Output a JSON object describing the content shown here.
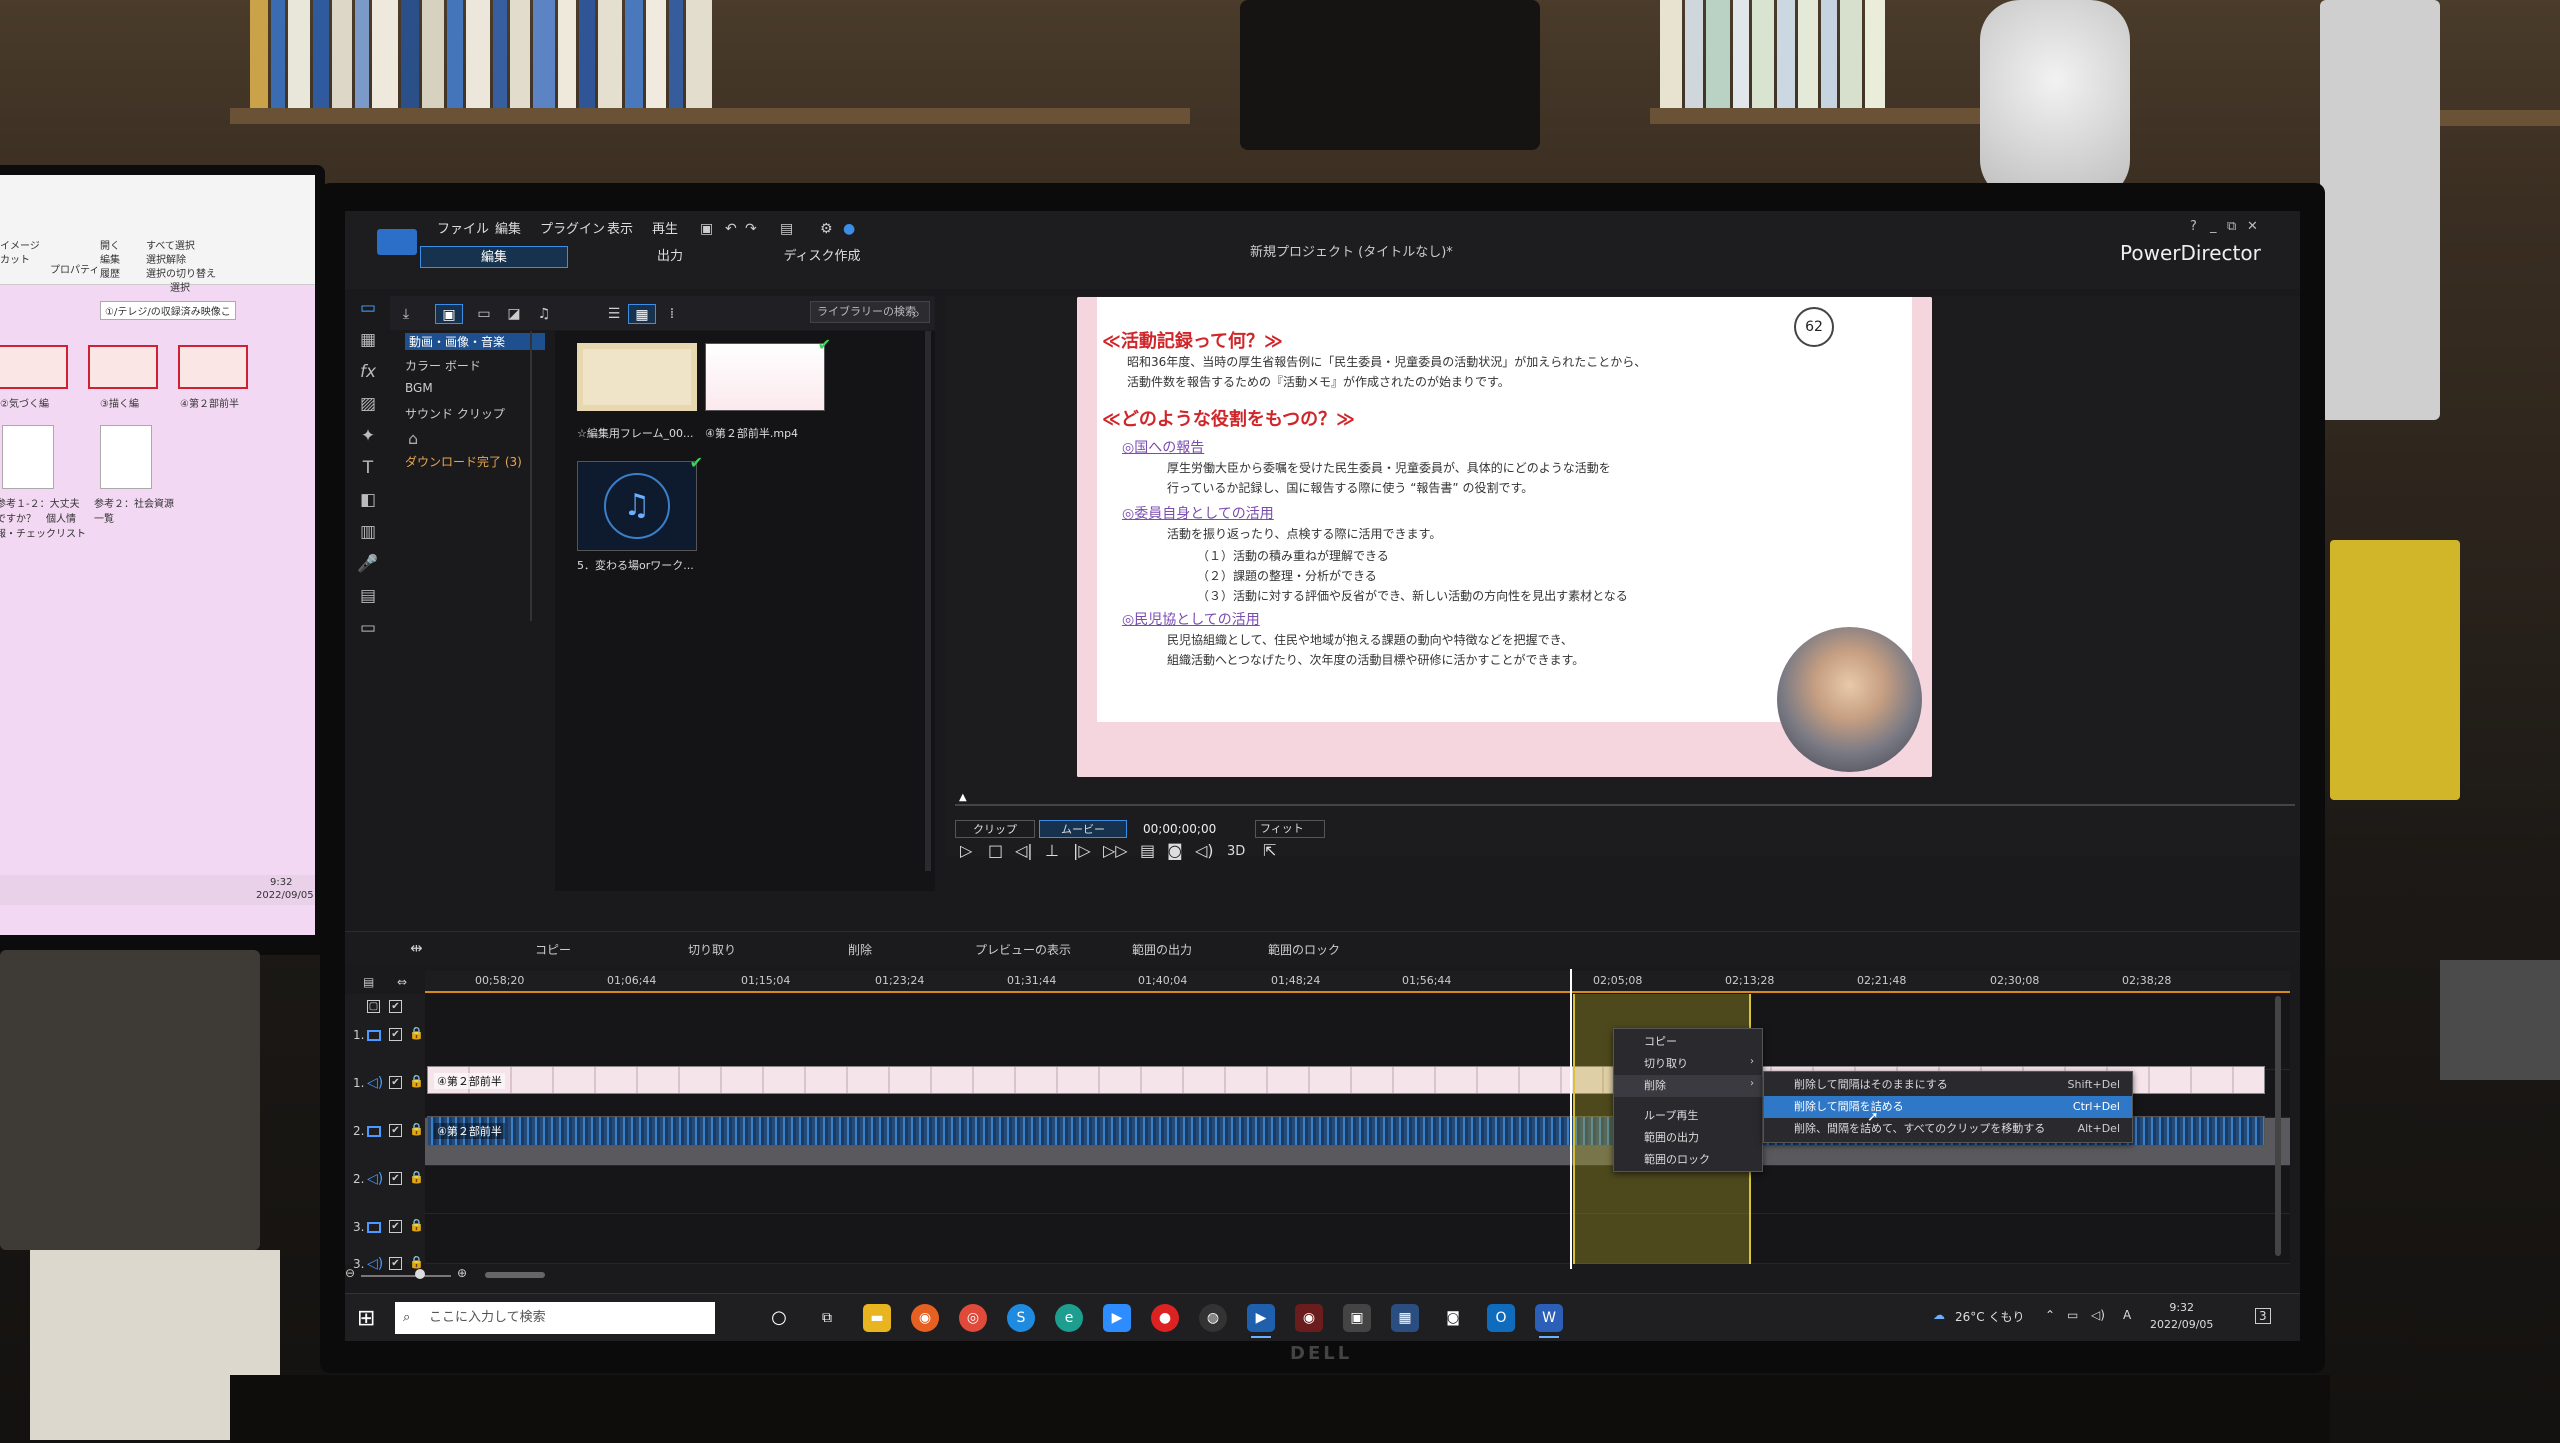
{
  "left_monitor": {
    "ribbon": [
      "イメージ",
      "カット",
      "すべて選択",
      "選択解除",
      "選択の切り替え",
      "開く",
      "編集",
      "履歴",
      "プロパティ",
      "選択"
    ],
    "path_search": "①/テレジ/の収録済み映像こ",
    "thumbs": [
      "②気づく編",
      "③描く編",
      "④第２部前半"
    ],
    "files": [
      "参考１-２：大丈夫ですか？　個人情報・チェックリスト",
      "参考２：社会資源一覧"
    ],
    "clock_time": "9:32",
    "clock_date": "2022/09/05"
  },
  "app": {
    "menu": [
      "ファイル",
      "編集",
      "プラグイン",
      "表示",
      "再生"
    ],
    "modes": [
      "編集",
      "出力",
      "ディスク作成"
    ],
    "title": "新規プロジェクト (タイトルなし)*",
    "brand": "PowerDirector",
    "window_buttons": [
      "?",
      "_",
      "⧉",
      "✕"
    ]
  },
  "library": {
    "search_placeholder": "ライブラリーの検索",
    "categories": [
      "動画・画像・音楽",
      "カラー ボード",
      "BGM",
      "サウンド クリップ"
    ],
    "downloads": "ダウンロード完了 (3)",
    "items": [
      {
        "label": "☆編集用フレーム_00..."
      },
      {
        "label": "④第２部前半.mp4"
      },
      {
        "label": "5．変わる場orワーク..."
      }
    ]
  },
  "slide": {
    "number": "62",
    "heading1": "≪活動記録って何？≫",
    "line1": "昭和36年度、当時の厚生省報告例に「民生委員・児童委員の活動状況」が加えられたことから、",
    "line2": "活動件数を報告するための『活動メモ』が作成されたのが始まりです。",
    "heading2": "≪どのような役割をもつの？≫",
    "sub1": "◎国への報告",
    "s1l1": "厚生労働大臣から委嘱を受けた民生委員・児童委員が、具体的にどのような活動を",
    "s1l2": "行っているか記録し、国に報告する際に使う “報告書” の役割です。",
    "sub2": "◎委員自身としての活用",
    "s2l1": "活動を振り返ったり、点検する際に活用できます。",
    "s2l2": "（１）活動の積み重ねが理解できる",
    "s2l3": "（２）課題の整理・分析ができる",
    "s2l4": "（３）活動に対する評価や反省ができ、新しい活動の方向性を見出す素材となる",
    "sub3": "◎民児協としての活用",
    "s3l1": "民児協組織として、住民や地域が抱える課題の動向や特徴などを把握でき、",
    "s3l2": "組織活動へとつなげたり、次年度の活動目標や研修に活かすことができます。"
  },
  "preview": {
    "tab_clip": "クリップ",
    "tab_movie": "ムービー",
    "timecode": "00;00;00;00",
    "fit": "フィット",
    "mode3d": "3D"
  },
  "timeline_tools": [
    "コピー",
    "切り取り",
    "削除",
    "プレビューの表示",
    "範囲の出力",
    "範囲のロック"
  ],
  "ruler": [
    "00;58;20",
    "01;06;44",
    "01;15;04",
    "01;23;24",
    "01;31;44",
    "01;40;04",
    "01;48;24",
    "01;56;44",
    "02;05;08",
    "02;13;28",
    "02;21;48",
    "02;30;08",
    "02;38;28"
  ],
  "tracks": [
    "1.",
    "1.",
    "2.",
    "2.",
    "3.",
    "3."
  ],
  "clips": {
    "video": "④第２部前半",
    "audio": "④第２部前半"
  },
  "context_menu": [
    "コピー",
    "切り取り",
    "削除",
    "ループ再生",
    "範囲の出力",
    "範囲のロック"
  ],
  "submenu": [
    {
      "label": "削除して間隔はそのままにする",
      "shortcut": "Shift+Del"
    },
    {
      "label": "削除して間隔を詰める",
      "shortcut": "Ctrl+Del"
    },
    {
      "label": "削除、間隔を詰めて、すべてのクリップを移動する",
      "shortcut": "Alt+Del"
    }
  ],
  "taskbar": {
    "search_placeholder": "ここに入力して検索",
    "weather": "26°C くもり",
    "ime": "A",
    "time": "9:32",
    "date": "2022/09/05",
    "notify": "3"
  },
  "monitor_brand": "DELL",
  "colors": {
    "accent": "#3b8de6",
    "range": "#d8c43a",
    "slide_red": "#d0262a"
  }
}
